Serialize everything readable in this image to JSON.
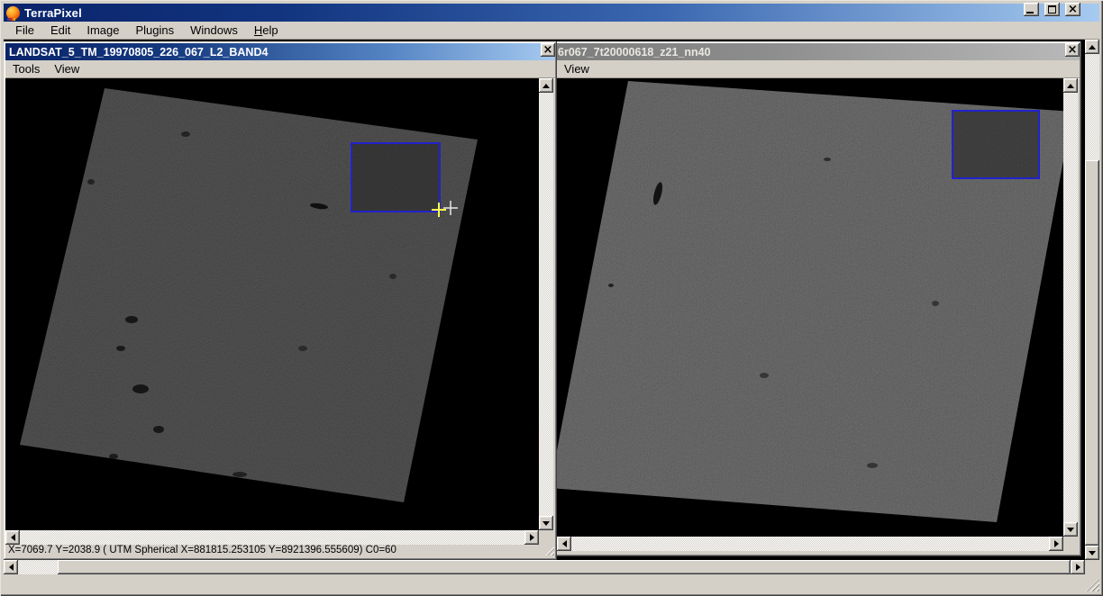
{
  "app": {
    "title": "TerraPixel",
    "menu": [
      "File",
      "Edit",
      "Image",
      "Plugins",
      "Windows",
      "Help"
    ]
  },
  "left_window": {
    "title": "LANDSAT_5_TM_19970805_226_067_L2_BAND4",
    "menu": [
      "Tools",
      "View"
    ],
    "status_bar": "X=7069.7 Y=2038.9 ( UTM Spherical X=881815.253105 Y=8921396.555609) C0=60",
    "state": "active"
  },
  "right_window": {
    "title": "6r067_7t20000618_z21_nn40",
    "menu": [
      "View"
    ],
    "state": "inactive"
  },
  "icons": {
    "close": "×"
  },
  "colors": {
    "chrome": "#d4d0c8",
    "titlebar_active_start": "#0a246a",
    "titlebar_active_end": "#a6caf0",
    "titlebar_inactive": "#8d8d8d",
    "mdi_background": "#000000",
    "selection_rectangle": "#2222cc",
    "crosshair_yellow": "#ffff4d",
    "crosshair_white": "#e8e8e8",
    "left_image_gray": "#3a3a3a",
    "right_image_gray": "#555555"
  }
}
